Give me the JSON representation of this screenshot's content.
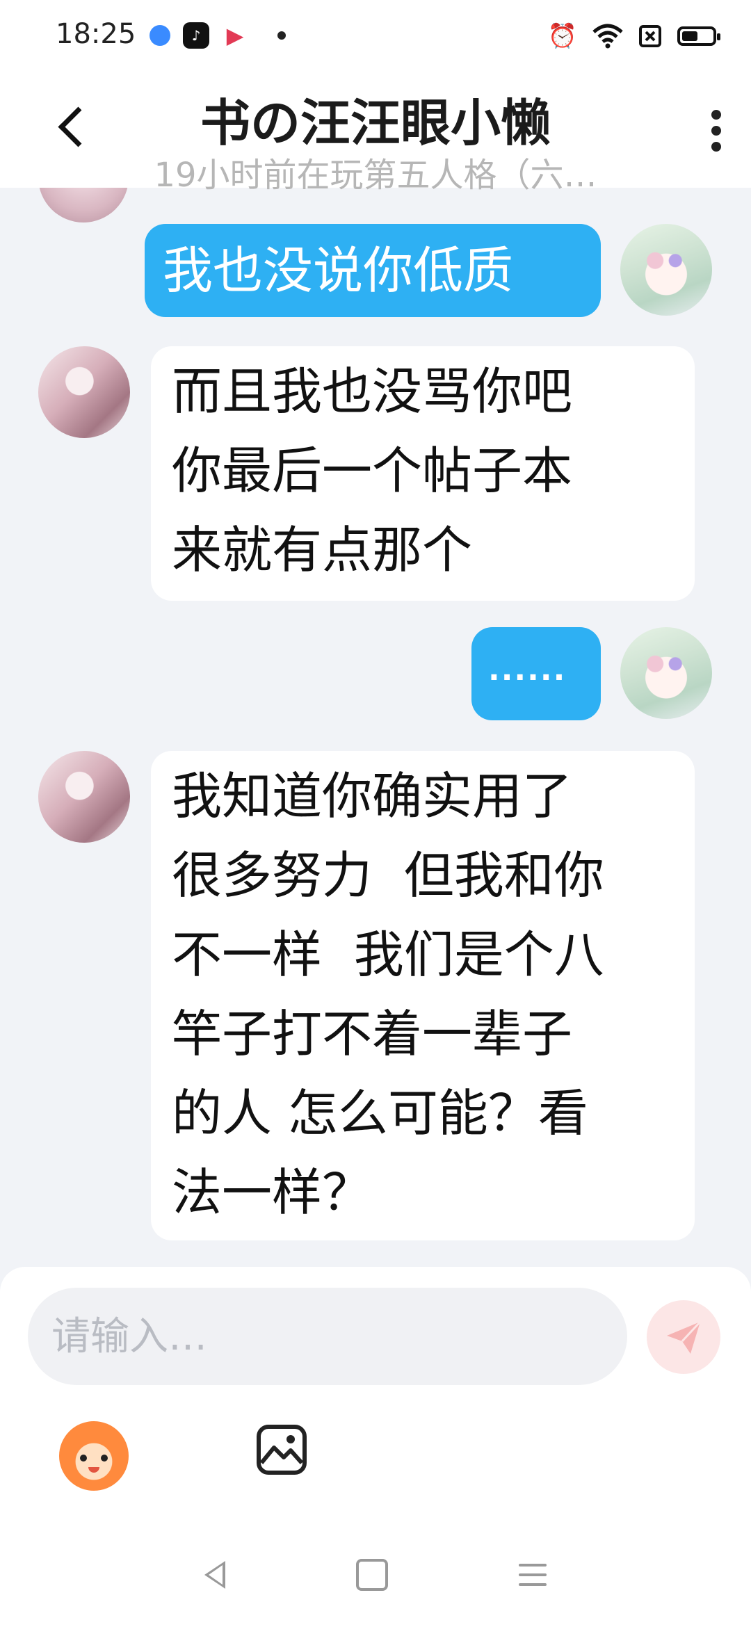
{
  "status_bar": {
    "time": "18:25",
    "apps": [
      "browser-app-icon",
      "tiktok-app-icon",
      "video-app-icon"
    ],
    "icons": [
      "alarm-icon",
      "wifi-icon",
      "sim-off-icon",
      "battery-icon"
    ]
  },
  "header": {
    "title": "书の汪汪眼小懒",
    "subtitle": "19小时前在玩第五人格（六…"
  },
  "messages": [
    {
      "sender": "me",
      "text": "我也没说你低质"
    },
    {
      "sender": "other",
      "text": "而且我也没骂你吧\n你最后一个帖子本\n来就有点那个"
    },
    {
      "sender": "me",
      "text": "......"
    },
    {
      "sender": "other",
      "text": "我知道你确实用了\n很多努力  但我和你\n不一样  我们是个八\n竿子打不着一辈子\n的人 怎么可能？看\n法一样？"
    }
  ],
  "input": {
    "placeholder": "请输入…",
    "value": ""
  },
  "toolbar": {
    "emoji_icon": "emoji-mascot-icon",
    "image_icon": "image-icon",
    "send_icon": "send-icon"
  },
  "colors": {
    "accent": "#2eb0f3",
    "background": "#f1f3f7",
    "send_button_bg": "#fce6e6",
    "send_button_fg": "#f6b3b3"
  }
}
